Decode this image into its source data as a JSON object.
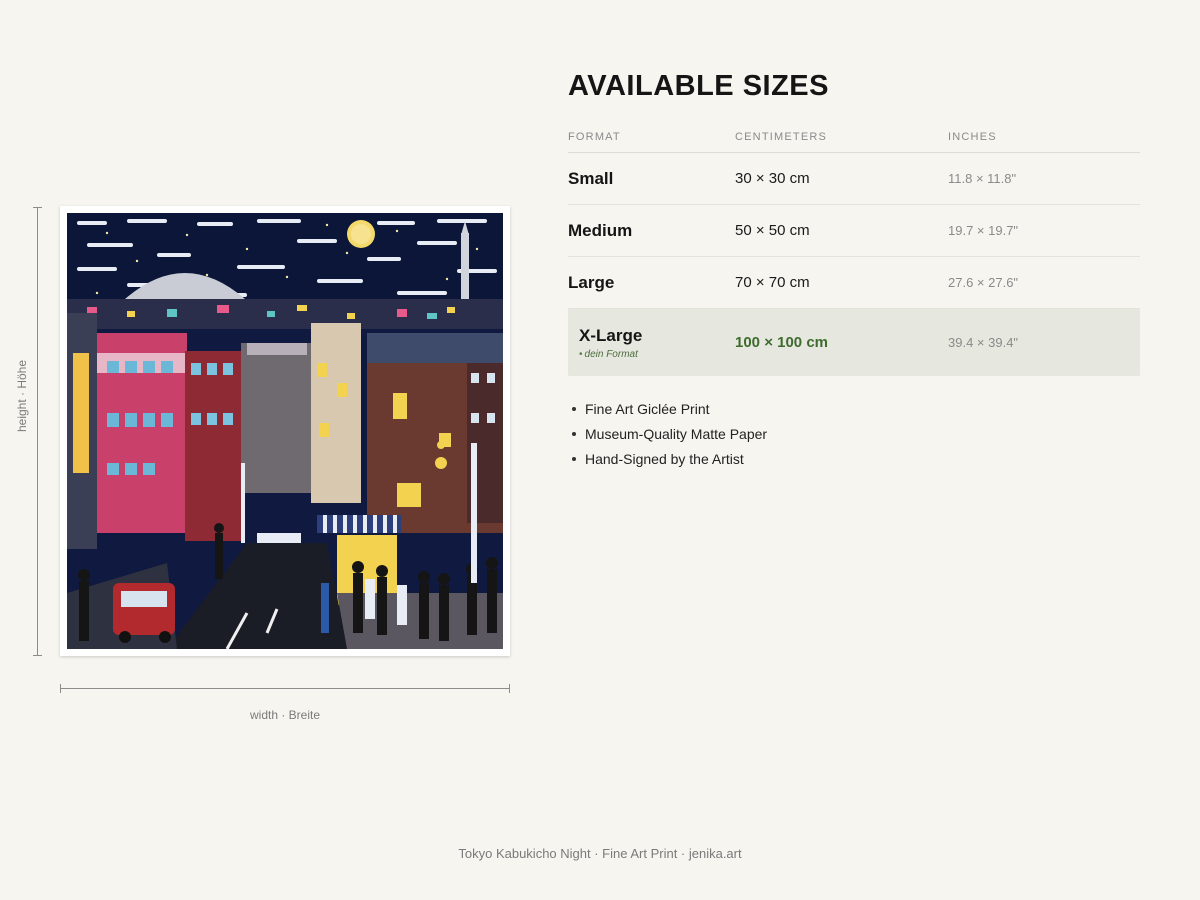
{
  "artwork": {
    "height_label": "height · Höhe",
    "width_label": "width · Breite"
  },
  "sizes": {
    "title": "AVAILABLE SIZES",
    "headers": {
      "format": "FORMAT",
      "centimeters": "CENTIMETERS",
      "inches": "INCHES"
    },
    "rows": [
      {
        "format": "Small",
        "cm": "30 × 30 cm",
        "inches": "11.8 × 11.8\""
      },
      {
        "format": "Medium",
        "cm": "50 × 50 cm",
        "inches": "19.7 × 19.7\""
      },
      {
        "format": "Large",
        "cm": "70 × 70 cm",
        "inches": "27.6 × 27.6\""
      },
      {
        "format": "X-Large",
        "note": "dein Format",
        "cm": "100 × 100 cm",
        "inches": "39.4 × 39.4\"",
        "highlighted": true
      }
    ]
  },
  "features": [
    "Fine Art Giclée Print",
    "Museum-Quality Matte Paper",
    "Hand-Signed by the Artist"
  ],
  "footer": "Tokyo Kabukicho Night · Fine Art Print · jenika.art",
  "colors": {
    "background": "#f6f5f0",
    "highlight_row": "#e6e8df",
    "accent_green": "#3f6b2f",
    "night_sky": "#0e1a3f"
  }
}
